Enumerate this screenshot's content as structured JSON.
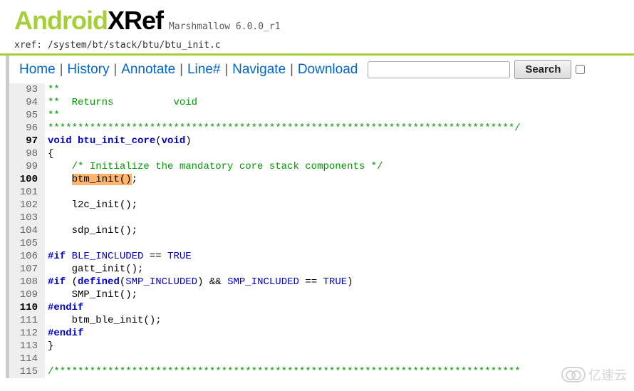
{
  "logo": {
    "part1": "Android",
    "part2": "XRef",
    "version": "Marshmallow 6.0.0_r1"
  },
  "path": {
    "prefix": "xref: ",
    "value": "/system/bt/stack/btu/btu_init.c"
  },
  "nav": {
    "home": "Home",
    "history": "History",
    "annotate": "Annotate",
    "line": "Line#",
    "navigate": "Navigate",
    "download": "Download",
    "search_btn": "Search",
    "search_placeholder": ""
  },
  "code": [
    {
      "n": "93",
      "bold": false,
      "segs": [
        {
          "t": "**",
          "c": "cm"
        }
      ]
    },
    {
      "n": "94",
      "bold": false,
      "segs": [
        {
          "t": "**  Returns          ",
          "c": "cm"
        },
        {
          "t": "void",
          "c": "cm"
        }
      ]
    },
    {
      "n": "95",
      "bold": false,
      "segs": [
        {
          "t": "**",
          "c": "cm"
        }
      ]
    },
    {
      "n": "96",
      "bold": false,
      "segs": [
        {
          "t": "******************************************************************************/",
          "c": "cm"
        }
      ]
    },
    {
      "n": "97",
      "bold": true,
      "segs": [
        {
          "t": "void",
          "c": "kw"
        },
        {
          "t": " ",
          "c": ""
        },
        {
          "t": "btu_init_core",
          "c": "fn"
        },
        {
          "t": "(",
          "c": ""
        },
        {
          "t": "void",
          "c": "kw"
        },
        {
          "t": ")",
          "c": ""
        }
      ]
    },
    {
      "n": "98",
      "bold": false,
      "segs": [
        {
          "t": "{",
          "c": ""
        }
      ]
    },
    {
      "n": "99",
      "bold": false,
      "segs": [
        {
          "t": "    ",
          "c": ""
        },
        {
          "t": "/* Initialize the mandatory core stack components */",
          "c": "cm"
        }
      ]
    },
    {
      "n": "100",
      "bold": true,
      "segs": [
        {
          "t": "    ",
          "c": ""
        },
        {
          "t": "btm_init",
          "c": "hl"
        },
        {
          "t": "()",
          "c": "hl"
        },
        {
          "t": ";",
          "c": ""
        }
      ]
    },
    {
      "n": "101",
      "bold": false,
      "segs": []
    },
    {
      "n": "102",
      "bold": false,
      "segs": [
        {
          "t": "    l2c_init();",
          "c": ""
        }
      ]
    },
    {
      "n": "103",
      "bold": false,
      "segs": []
    },
    {
      "n": "104",
      "bold": false,
      "segs": [
        {
          "t": "    sdp_init();",
          "c": ""
        }
      ]
    },
    {
      "n": "105",
      "bold": false,
      "segs": []
    },
    {
      "n": "106",
      "bold": false,
      "segs": [
        {
          "t": "#if",
          "c": "dir"
        },
        {
          "t": " ",
          "c": ""
        },
        {
          "t": "BLE_INCLUDED",
          "c": "macro"
        },
        {
          "t": " == ",
          "c": ""
        },
        {
          "t": "TRUE",
          "c": "macro"
        }
      ]
    },
    {
      "n": "107",
      "bold": false,
      "segs": [
        {
          "t": "    gatt_init();",
          "c": ""
        }
      ]
    },
    {
      "n": "108",
      "bold": false,
      "segs": [
        {
          "t": "#if",
          "c": "dir"
        },
        {
          "t": " (",
          "c": ""
        },
        {
          "t": "defined",
          "c": "kw"
        },
        {
          "t": "(",
          "c": ""
        },
        {
          "t": "SMP_INCLUDED",
          "c": "macro"
        },
        {
          "t": ") && ",
          "c": ""
        },
        {
          "t": "SMP_INCLUDED",
          "c": "macro"
        },
        {
          "t": " == ",
          "c": ""
        },
        {
          "t": "TRUE",
          "c": "macro"
        },
        {
          "t": ")",
          "c": ""
        }
      ]
    },
    {
      "n": "109",
      "bold": false,
      "segs": [
        {
          "t": "    SMP_Init();",
          "c": ""
        }
      ]
    },
    {
      "n": "110",
      "bold": true,
      "segs": [
        {
          "t": "#endif",
          "c": "dir"
        }
      ]
    },
    {
      "n": "111",
      "bold": false,
      "segs": [
        {
          "t": "    btm_ble_init();",
          "c": ""
        }
      ]
    },
    {
      "n": "112",
      "bold": false,
      "segs": [
        {
          "t": "#endif",
          "c": "dir"
        }
      ]
    },
    {
      "n": "113",
      "bold": false,
      "segs": [
        {
          "t": "}",
          "c": ""
        }
      ]
    },
    {
      "n": "114",
      "bold": false,
      "segs": []
    },
    {
      "n": "115",
      "bold": false,
      "segs": [
        {
          "t": "/******************************************************************************",
          "c": "cm"
        }
      ]
    }
  ],
  "watermark": "亿速云"
}
